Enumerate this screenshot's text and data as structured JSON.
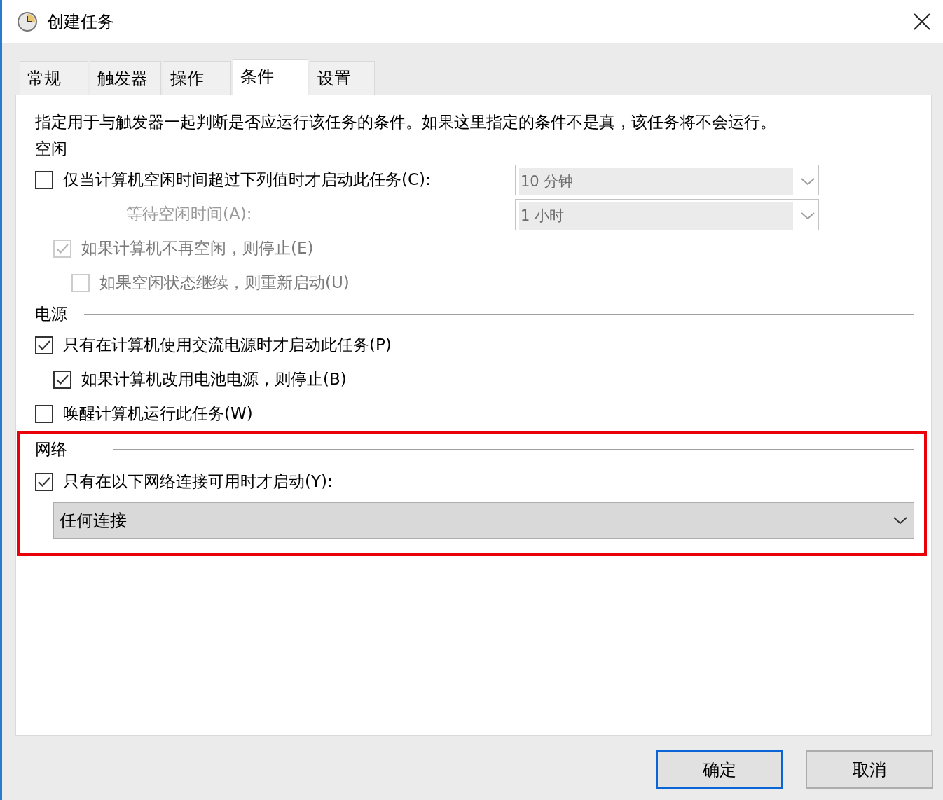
{
  "window": {
    "title": "创建任务"
  },
  "tabs": [
    {
      "label": "常规",
      "selected": false
    },
    {
      "label": "触发器",
      "selected": false
    },
    {
      "label": "操作",
      "selected": false
    },
    {
      "label": "条件",
      "selected": true
    },
    {
      "label": "设置",
      "selected": false
    }
  ],
  "description": "指定用于与触发器一起判断是否应运行该任务的条件。如果这里指定的条件不是真，该任务将不会运行。",
  "sections": [
    {
      "title": "空闲",
      "highlighted": false,
      "items": [
        {
          "kind": "checkbox",
          "label": "仅当计算机空闲时间超过下列值时才启动此任务(C):",
          "checked": false,
          "disabled": false,
          "dropdown": {
            "value": "10 分钟",
            "disabled": true
          },
          "children": [
            {
              "kind": "field",
              "label": "等待空闲时间(A):",
              "disabled": true,
              "dropdown": {
                "value": "1 小时",
                "disabled": true
              }
            },
            {
              "kind": "checkbox",
              "label": "如果计算机不再空闲，则停止(E)",
              "checked": true,
              "disabled": true,
              "children": [
                {
                  "kind": "checkbox",
                  "label": "如果空闲状态继续，则重新启动(U)",
                  "checked": false,
                  "disabled": true
                }
              ]
            }
          ]
        }
      ]
    },
    {
      "title": "电源",
      "highlighted": false,
      "items": [
        {
          "kind": "checkbox",
          "label": "只有在计算机使用交流电源时才启动此任务(P)",
          "checked": true,
          "disabled": false,
          "children": [
            {
              "kind": "checkbox",
              "label": "如果计算机改用电池电源，则停止(B)",
              "checked": true,
              "disabled": false
            }
          ]
        },
        {
          "kind": "checkbox",
          "label": "唤醒计算机运行此任务(W)",
          "checked": false,
          "disabled": false
        }
      ]
    },
    {
      "title": "网络",
      "highlighted": true,
      "items": [
        {
          "kind": "checkbox",
          "label": "只有在以下网络连接可用时才启动(Y):",
          "checked": true,
          "disabled": false,
          "children": [
            {
              "kind": "select",
              "value": "任何连接",
              "disabled": false
            }
          ]
        }
      ]
    }
  ],
  "buttons": [
    {
      "label": "确定",
      "focused": true
    },
    {
      "label": "取消",
      "focused": false
    }
  ]
}
